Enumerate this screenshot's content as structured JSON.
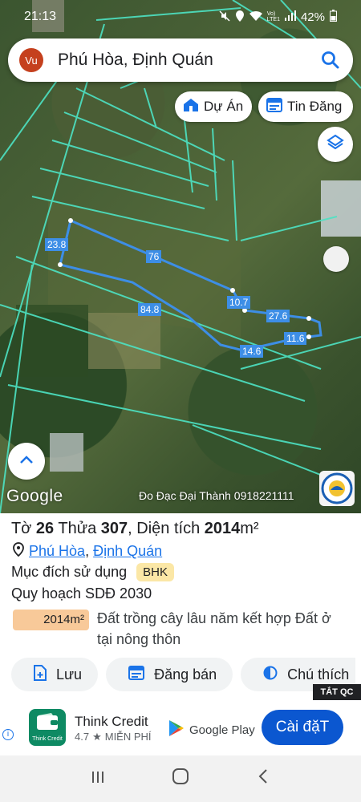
{
  "status_bar": {
    "time": "21:13",
    "battery": "42%",
    "icons": [
      "mute-icon",
      "location-icon",
      "wifi-icon",
      "volte-icon",
      "signal-icon"
    ]
  },
  "search": {
    "avatar_initials": "Vu",
    "query": "Phú Hòa, Định Quán"
  },
  "chips": {
    "du_an": "Dự Án",
    "tin_dang": "Tin Đăng"
  },
  "map": {
    "measurements": [
      "23.8",
      "76",
      "84.8",
      "10.7",
      "27.6",
      "11.6",
      "14.6"
    ],
    "google_label": "Google",
    "attribution": "Đo Đạc Đại Thành 0918221111"
  },
  "parcel": {
    "sheet_label": "Tờ",
    "sheet_no": "26",
    "plot_label": "Thửa",
    "plot_no": "307",
    "area_label": ", Diện tích",
    "area_value": "2014",
    "area_unit": "m²",
    "commune": "Phú Hòa",
    "separator": ",",
    "district": "Định Quán",
    "purpose_label": "Mục đích sử dụng",
    "purpose_code": "BHK",
    "plan_label": "Quy hoạch SDĐ 2030",
    "plan_area": "2014m²",
    "plan_desc": "Đất trồng cây lâu năm kết hợp Đất ở tại nông thôn"
  },
  "actions": {
    "save": "Lưu",
    "post_sale": "Đăng bán",
    "notes": "Chú thích",
    "hide_ads": "TẮT QC"
  },
  "ad": {
    "app_name": "Think Credit",
    "icon_caption": "Think Credit",
    "rating": "4.7",
    "price": "MIỄN PHÍ",
    "store": "Google Play",
    "install": "Cài đặT"
  },
  "colors": {
    "accent": "#1a73e8",
    "parcel_line": "#3d8ee6",
    "lot_lines": "#4de3c4",
    "install_bg": "#0b57d0"
  }
}
